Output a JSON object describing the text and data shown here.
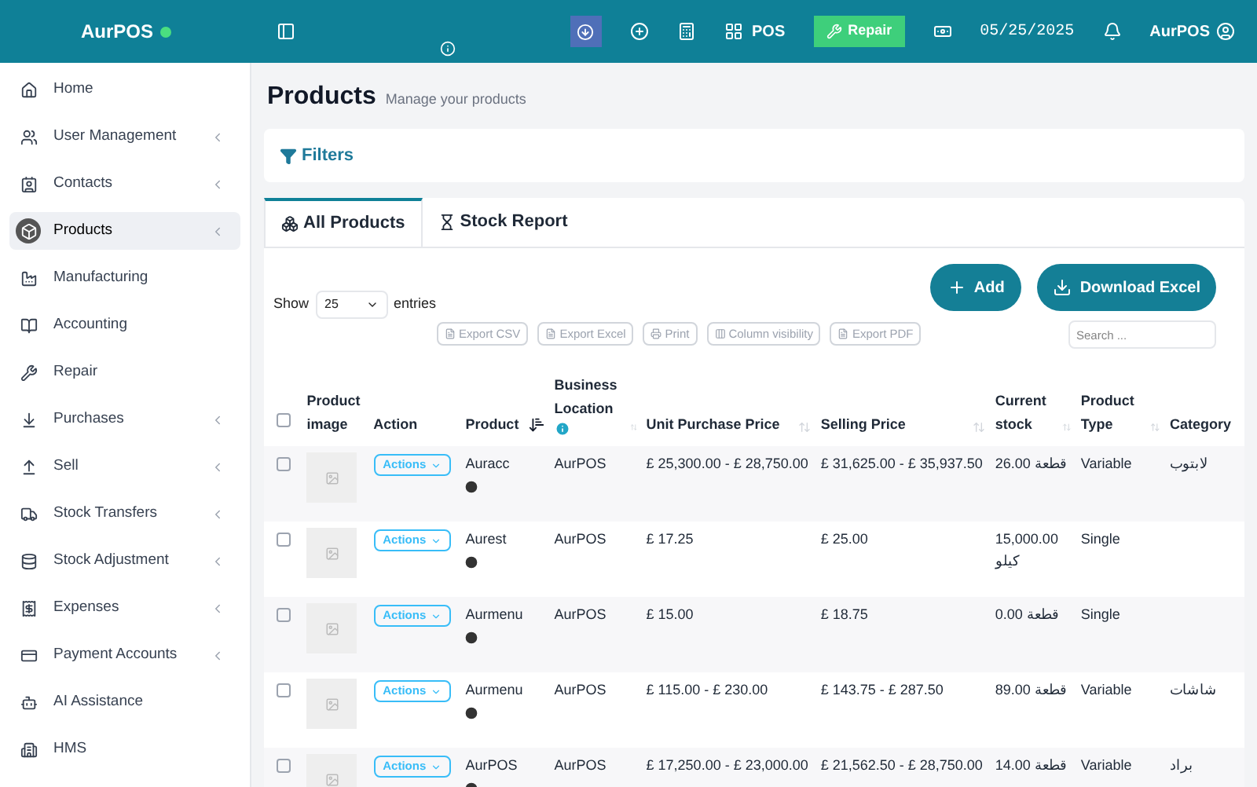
{
  "topbar": {
    "logo": "AurPOS",
    "pos_label": "POS",
    "repair_button": "Repair",
    "date": "05/25/2025",
    "user": "AurPOS"
  },
  "sidebar": {
    "items": [
      {
        "label": "Home",
        "expandable": false,
        "selected": false
      },
      {
        "label": "User Management",
        "expandable": true,
        "selected": false
      },
      {
        "label": "Contacts",
        "expandable": true,
        "selected": false
      },
      {
        "label": "Products",
        "expandable": true,
        "selected": true
      },
      {
        "label": "Manufacturing",
        "expandable": false,
        "selected": false
      },
      {
        "label": "Accounting",
        "expandable": false,
        "selected": false
      },
      {
        "label": "Repair",
        "expandable": false,
        "selected": false
      },
      {
        "label": "Purchases",
        "expandable": true,
        "selected": false
      },
      {
        "label": "Sell",
        "expandable": true,
        "selected": false
      },
      {
        "label": "Stock Transfers",
        "expandable": true,
        "selected": false
      },
      {
        "label": "Stock Adjustment",
        "expandable": true,
        "selected": false
      },
      {
        "label": "Expenses",
        "expandable": true,
        "selected": false
      },
      {
        "label": "Payment Accounts",
        "expandable": true,
        "selected": false
      },
      {
        "label": "AI Assistance",
        "expandable": false,
        "selected": false
      },
      {
        "label": "HMS",
        "expandable": false,
        "selected": false
      }
    ]
  },
  "page": {
    "title": "Products",
    "subtitle": "Manage your products"
  },
  "filters": {
    "label": "Filters"
  },
  "tabs": [
    {
      "label": "All Products",
      "selected": true
    },
    {
      "label": "Stock Report",
      "selected": false
    }
  ],
  "actions": {
    "add": "Add",
    "download": "Download Excel"
  },
  "length": {
    "show": "Show",
    "value": "25",
    "entries": "entries"
  },
  "export_buttons": [
    "Export CSV",
    "Export Excel",
    "Print",
    "Column visibility",
    "Export PDF"
  ],
  "search": {
    "placeholder": "Search ..."
  },
  "table": {
    "select_all": {
      "checked": false
    },
    "columns": [
      {
        "label": "Product image",
        "kind": "plain"
      },
      {
        "label": "Action",
        "kind": "plain"
      },
      {
        "label": "Product",
        "kind": "sorted"
      },
      {
        "label": "Business Location",
        "kind": "sortable",
        "info": true
      },
      {
        "label": "Unit Purchase Price",
        "kind": "sortable"
      },
      {
        "label": "Selling Price",
        "kind": "sortable"
      },
      {
        "label": "Current stock",
        "kind": "sortable"
      },
      {
        "label": "Product Type",
        "kind": "sortable"
      },
      {
        "label": "Category",
        "kind": "plain"
      }
    ],
    "rows": [
      {
        "checked": false,
        "action": "Actions",
        "product": "Auracc",
        "location": "AurPOS",
        "unit_price": "£ 25,300.00 - £ 28,750.00",
        "selling_price": "£ 31,625.00 - £ 35,937.50",
        "stock": "26.00 قطعة",
        "type": "Variable",
        "category": "لابتوب"
      },
      {
        "checked": false,
        "action": "Actions",
        "product": "Aurest",
        "location": "AurPOS",
        "unit_price": "£ 17.25",
        "selling_price": "£ 25.00",
        "stock": "15,000.00 كيلو",
        "type": "Single"
      },
      {
        "checked": false,
        "action": "Actions",
        "product": "Aurmenu",
        "location": "AurPOS",
        "unit_price": "£ 15.00",
        "selling_price": "£ 18.75",
        "stock": "0.00 قطعة",
        "type": "Single"
      },
      {
        "checked": false,
        "action": "Actions",
        "product": "Aurmenu",
        "location": "AurPOS",
        "unit_price": "£ 115.00 - £ 230.00",
        "selling_price": "£ 143.75 - £ 287.50",
        "stock": "89.00 قطعة",
        "type": "Variable",
        "category": "شاشات"
      },
      {
        "checked": false,
        "action": "Actions",
        "product": "AurPOS",
        "location": "AurPOS",
        "unit_price": "£ 17,250.00 - £ 23,000.00",
        "selling_price": "£ 21,562.50 - £ 28,750.00",
        "stock": "14.00 قطعة",
        "type": "Variable",
        "category": "براد"
      }
    ]
  }
}
